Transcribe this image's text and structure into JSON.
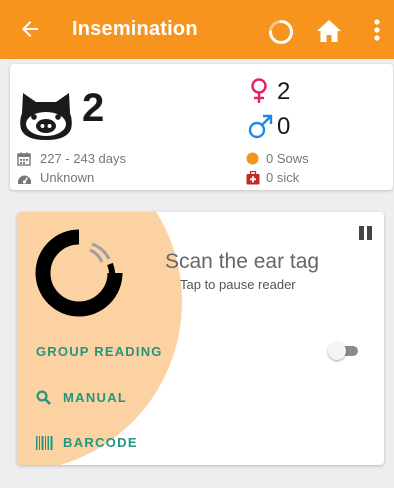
{
  "appbar": {
    "title": "Insemination",
    "back_icon": "arrow-back-icon",
    "loading_icon": "loading-spinner-icon",
    "home_icon": "home-icon",
    "menu_icon": "more-vert-icon",
    "color": "#f7941d"
  },
  "summary": {
    "pig_count": "2",
    "female_count": "2",
    "male_count": "0",
    "age_range": "227 - 243 days",
    "health": "Unknown",
    "sows": "0 Sows",
    "sick": "0 sick",
    "colors": {
      "female": "#e91e63",
      "male": "#1e88e5",
      "sows_dot": "#f7941d",
      "sick": "#c62828"
    }
  },
  "reader": {
    "scan_title": "Scan the ear tag",
    "scan_subtitle": "Tap to pause reader",
    "group_reading_label": "GROUP READING",
    "group_reading_enabled": false,
    "manual_label": "MANUAL",
    "barcode_label": "BARCODE",
    "accent": "#23967f",
    "halo_color": "#fcd2a2"
  }
}
